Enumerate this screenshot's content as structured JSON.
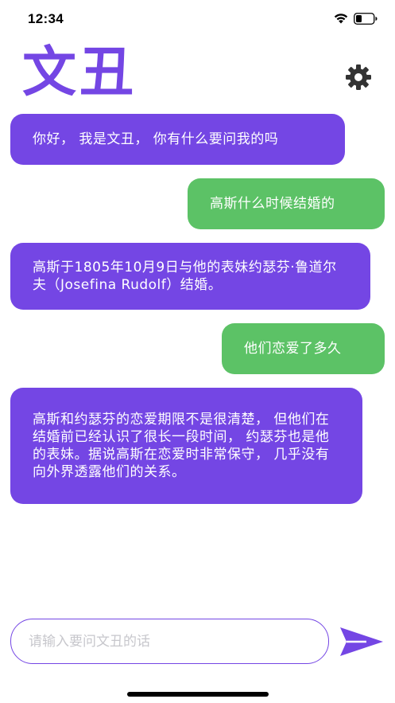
{
  "status_bar": {
    "time": "12:34",
    "icons": [
      "wifi-icon",
      "battery-icon"
    ]
  },
  "header": {
    "title": "文丑",
    "settings_icon": "gear-icon"
  },
  "messages": [
    {
      "role": "bot",
      "text": "你好， 我是文丑， 你有什么要问我的吗"
    },
    {
      "role": "user",
      "text": "高斯什么时候结婚的"
    },
    {
      "role": "bot",
      "text": "高斯于1805年10月9日与他的表妹约瑟芬·鲁道尔夫（Josefina Rudolf）结婚。"
    },
    {
      "role": "user",
      "text": "他们恋爱了多久"
    },
    {
      "role": "bot",
      "text": "高斯和约瑟芬的恋爱期限不是很清楚， 但他们在结婚前已经认识了很长一段时间， 约瑟芬也是他的表妹。据说高斯在恋爱时非常保守， 几乎没有向外界透露他们的关系。"
    }
  ],
  "composer": {
    "placeholder": "请输入要问文丑的话",
    "value": "",
    "send_icon": "send-icon"
  },
  "colors": {
    "accent": "#7446e4",
    "user_bubble": "#5cc266"
  }
}
